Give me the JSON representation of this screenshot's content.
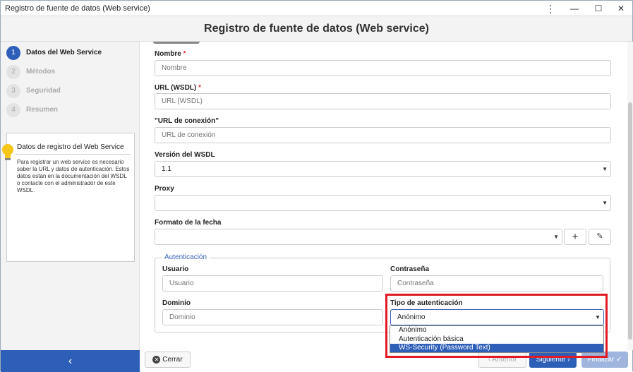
{
  "window": {
    "title": "Registro de fuente de datos (Web service)"
  },
  "header": {
    "title": "Registro de fuente de datos (Web service)"
  },
  "steps": [
    {
      "num": "1",
      "label": "Datos del Web Service",
      "active": true
    },
    {
      "num": "2",
      "label": "Métodos",
      "active": false
    },
    {
      "num": "3",
      "label": "Seguridad",
      "active": false
    },
    {
      "num": "4",
      "label": "Resumen",
      "active": false
    }
  ],
  "info": {
    "title": "Datos de registro del Web Service",
    "text": "Para registrar un web service es necesario saber la URL y datos de autenticación. Estos datos están en la documentación del WSDL o contacte con el administrador de este WSDL."
  },
  "form": {
    "nombre": {
      "label": "Nombre",
      "required": "*",
      "placeholder": "Nombre"
    },
    "url_wsdl": {
      "label": "URL (WSDL)",
      "required": "*",
      "placeholder": "URL (WSDL)"
    },
    "url_conexion": {
      "label": "\"URL de conexión\"",
      "placeholder": "URL de conexión"
    },
    "version": {
      "label": "Versión del WSDL",
      "value": "1.1"
    },
    "proxy": {
      "label": "Proxy",
      "value": ""
    },
    "formato": {
      "label": "Formato de la fecha",
      "value": ""
    },
    "auth": {
      "legend": "Autenticación",
      "usuario": {
        "label": "Usuario",
        "placeholder": "Usuario"
      },
      "contrasena": {
        "label": "Contraseña",
        "placeholder": "Contraseña"
      },
      "dominio": {
        "label": "Dominio",
        "placeholder": "Dominio"
      },
      "tipo": {
        "label": "Tipo de autenticación",
        "value": "Anónimo",
        "options": [
          "Anónimo",
          "Autenticación básica",
          "WS-Security (Password Text)"
        ],
        "highlighted": "WS-Security (Password Text)"
      }
    }
  },
  "footer": {
    "close": "Cerrar",
    "prev": "Anterior",
    "next": "Siguiente",
    "finish": "Finalizar"
  },
  "colors": {
    "accent": "#2e5fb8",
    "highlight_box": "#e01b24"
  }
}
